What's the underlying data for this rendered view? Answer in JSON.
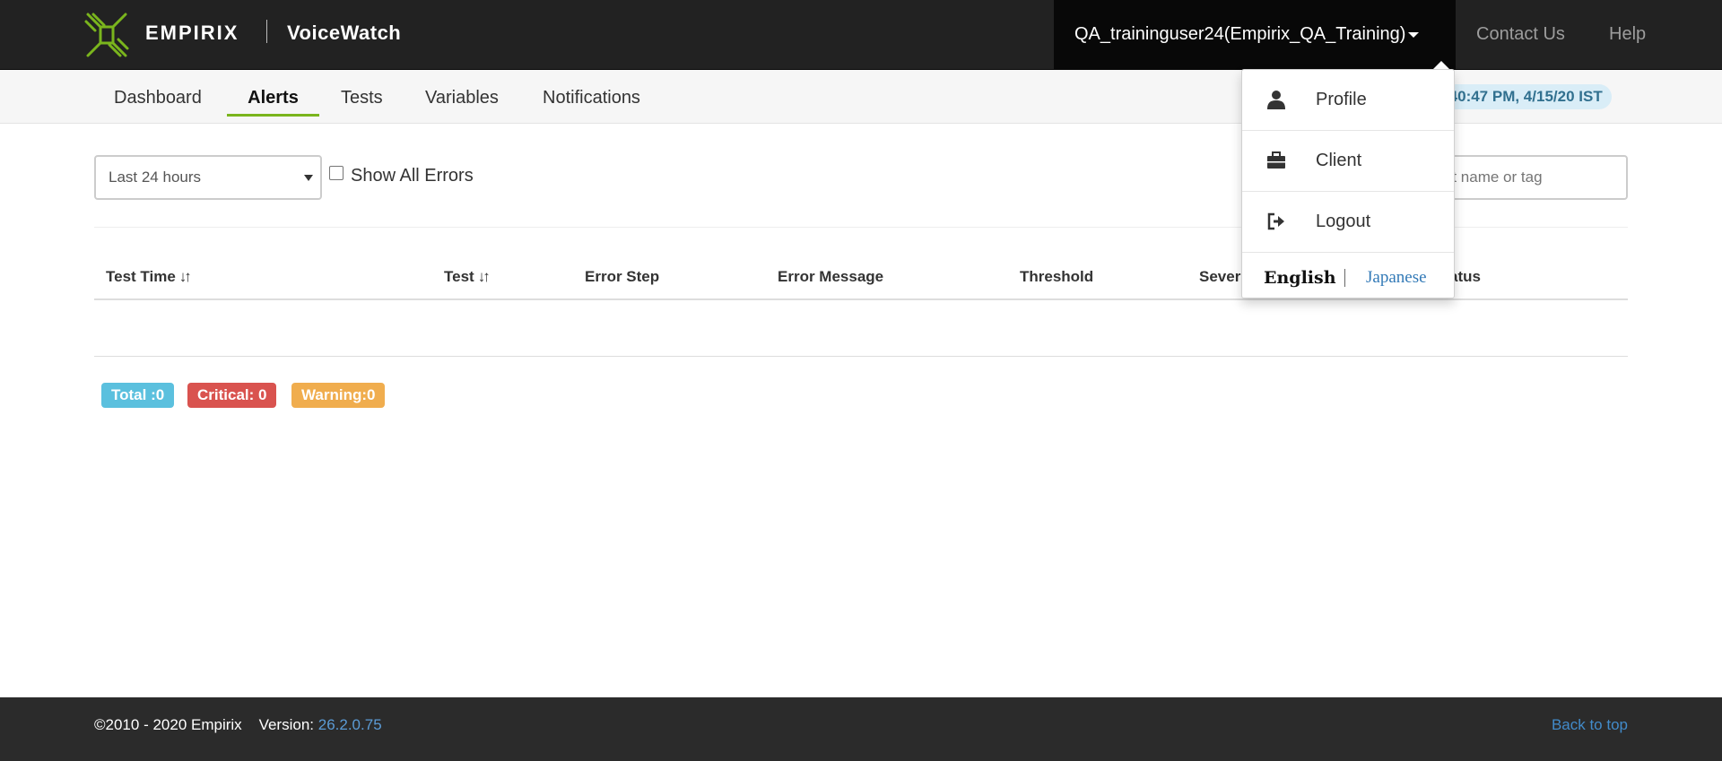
{
  "header": {
    "brand": "EMPIRIX",
    "product": "VoiceWatch",
    "user_menu_label": "QA_traininguser24(Empirix_QA_Training)",
    "links": [
      "Contact Us",
      "Help"
    ]
  },
  "nav": {
    "tabs": [
      {
        "label": "Dashboard",
        "active": false
      },
      {
        "label": "Alerts",
        "active": true
      },
      {
        "label": "Tests",
        "active": false
      },
      {
        "label": "Variables",
        "active": false
      },
      {
        "label": "Notifications",
        "active": false
      }
    ],
    "time_display": ":40:47 PM, 4/15/20 IST"
  },
  "filters": {
    "range_selected": "Last 24 hours",
    "show_all_errors_label": "Show All Errors",
    "show_all_errors_checked": false,
    "search_placeholder": "by test name or tag"
  },
  "table": {
    "columns": [
      "Test Time",
      "Test",
      "Error Step",
      "Error Message",
      "Threshold",
      "Sever",
      "atus"
    ],
    "rows": []
  },
  "summary": {
    "total": "Total :0",
    "critical": "Critical: 0",
    "warning": "Warning:0"
  },
  "user_dropdown": {
    "items": [
      {
        "label": "Profile",
        "icon": "user-icon"
      },
      {
        "label": "Client",
        "icon": "briefcase-icon"
      },
      {
        "label": "Logout",
        "icon": "logout-icon"
      }
    ],
    "languages": [
      "English",
      "Japanese"
    ],
    "selected_language": "English"
  },
  "footer": {
    "copyright": "©2010 - 2020 Empirix",
    "version_label": "Version:",
    "version": "26.2.0.75",
    "back_to_top": "Back to top"
  },
  "colors": {
    "topbar": "#222222",
    "accent_green": "#7ab51d",
    "badge_total": "#5bc0de",
    "badge_critical": "#d9534f",
    "badge_warning": "#f0ad4e",
    "link_blue": "#428bca"
  }
}
